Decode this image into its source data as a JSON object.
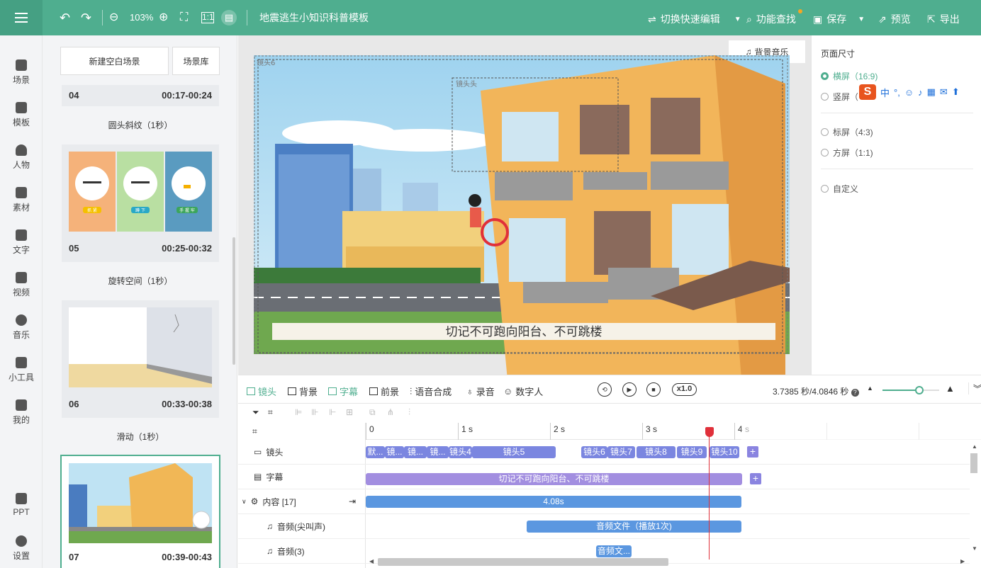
{
  "topbar": {
    "zoom": "103%",
    "doc_title": "地震逃生小知识科普模板",
    "switch_label": "切换快速编辑",
    "search_label": "功能查找",
    "save_label": "保存",
    "preview_label": "预览",
    "export_label": "导出",
    "colors": {
      "primary": "#4fae8f"
    }
  },
  "nav": [
    {
      "label": "场景",
      "icon": "scene-icon"
    },
    {
      "label": "模板",
      "icon": "template-icon"
    },
    {
      "label": "人物",
      "icon": "person-icon"
    },
    {
      "label": "素材",
      "icon": "material-icon"
    },
    {
      "label": "文字",
      "icon": "text-icon"
    },
    {
      "label": "视频",
      "icon": "video-icon"
    },
    {
      "label": "音乐",
      "icon": "music-icon"
    },
    {
      "label": "小工具",
      "icon": "tools-icon"
    },
    {
      "label": "我的",
      "icon": "upload-icon"
    },
    {
      "label": "PPT",
      "icon": "ppt-icon"
    },
    {
      "label": "设置",
      "icon": "gear-icon"
    }
  ],
  "scenes": {
    "new_blank": "新建空白场景",
    "library": "场景库",
    "items": [
      {
        "num": "04",
        "time": "00:17-00:24",
        "transition": "圆头斜纹（1秒）"
      },
      {
        "num": "05",
        "time": "00:25-00:32",
        "transition": "旋转空间（1秒）"
      },
      {
        "num": "06",
        "time": "00:33-00:38",
        "transition": "滑动（1秒）"
      },
      {
        "num": "07",
        "time": "00:39-00:43"
      }
    ],
    "card05_labels": [
      "抓 紧",
      "蹲 下",
      "手 握 牢"
    ]
  },
  "canvas": {
    "bg_music": "背景音乐",
    "camera_label_main": "镜头6",
    "camera_label_small": "镜头头",
    "subtitle": "切记不可跑向阳台、不可跳楼"
  },
  "page_size": {
    "title": "页面尺寸",
    "options": [
      {
        "label": "横屏（16:9)",
        "selected": true
      },
      {
        "label": "竖屏（",
        "selected": false
      },
      {
        "label": "标屏（4:3)",
        "selected": false
      },
      {
        "label": "方屏（1:1)",
        "selected": false
      },
      {
        "label": "自定义",
        "selected": false
      }
    ]
  },
  "ime": {
    "logo": "S",
    "lang": "中",
    "punct": "°,"
  },
  "track_tools": {
    "camera": "镜头",
    "background": "背景",
    "subtitle": "字幕",
    "foreground": "前景",
    "tts": "语音合成",
    "record": "录音",
    "avatar": "数字人",
    "speed": "x1.0",
    "time": "3.7385 秒/4.0846 秒",
    "zoom_level": 0.65
  },
  "timeline": {
    "ruler": [
      "0",
      "1 s",
      "2 s",
      "3 s",
      "4 s"
    ],
    "rows": [
      {
        "label": "镜头"
      },
      {
        "label": "字幕"
      },
      {
        "label": "内容 [17]"
      },
      {
        "label": "音频(尖叫声)"
      },
      {
        "label": "音频(3)"
      }
    ],
    "camera_clips": [
      "默...",
      "镜...",
      "镜...",
      "镜...",
      "镜头4",
      "镜头5",
      "镜头6",
      "镜头7",
      "镜头8",
      "镜头9",
      "镜头10"
    ],
    "subtitle_clip": "切记不可跑向阳台、不可跳楼",
    "content_clip": "4.08s",
    "audio1_clip": "音频文件（播放1次)",
    "audio2_clip": "音频文..."
  }
}
